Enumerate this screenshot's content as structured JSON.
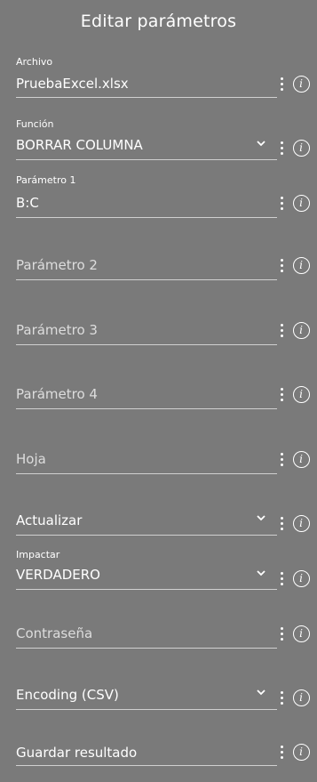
{
  "header": {
    "title": "Editar parámetros"
  },
  "fields": [
    {
      "label": "Archivo",
      "value": "PruebaExcel.xlsx",
      "dropdown": false
    },
    {
      "label": "Función",
      "value": "BORRAR COLUMNA",
      "dropdown": true
    },
    {
      "label": "Parámetro 1",
      "value": "B:C",
      "dropdown": false
    },
    {
      "placeholder": "Parámetro 2",
      "dropdown": false
    },
    {
      "placeholder": "Parámetro 3",
      "dropdown": false
    },
    {
      "placeholder": "Parámetro 4",
      "dropdown": false
    },
    {
      "placeholder": "Hoja",
      "dropdown": false
    },
    {
      "placeholder": "Actualizar",
      "dropdown": true
    },
    {
      "label": "Impactar",
      "value": "VERDADERO",
      "dropdown": true
    },
    {
      "placeholder": "Contraseña",
      "dropdown": false
    },
    {
      "placeholder": "Encoding (CSV)",
      "dropdown": true
    },
    {
      "placeholder": "Guardar resultado",
      "dropdown": false
    }
  ],
  "icons": {
    "menu": "kebab-menu-icon",
    "info": "info-icon",
    "dropdown": "chevron-down-icon"
  },
  "colors": {
    "background": "#7a7a7a",
    "text": "#ffffff",
    "underline": "#d0d0d0"
  }
}
